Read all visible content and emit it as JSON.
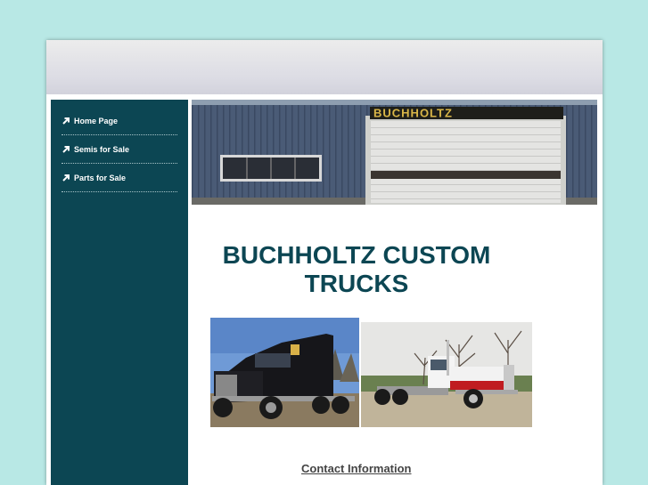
{
  "nav": {
    "items": [
      {
        "label": "Home Page"
      },
      {
        "label": "Semis for Sale"
      },
      {
        "label": "Parts for Sale"
      }
    ]
  },
  "banner": {
    "sign_text": "BUCHHOLTZ"
  },
  "main": {
    "title_line1": "BUCHHOLTZ CUSTOM",
    "title_line2": "TRUCKS",
    "contact_link": "Contact Information"
  },
  "colors": {
    "background": "#b8e8e5",
    "sidebar": "#0c4653",
    "title": "#0c4653"
  }
}
